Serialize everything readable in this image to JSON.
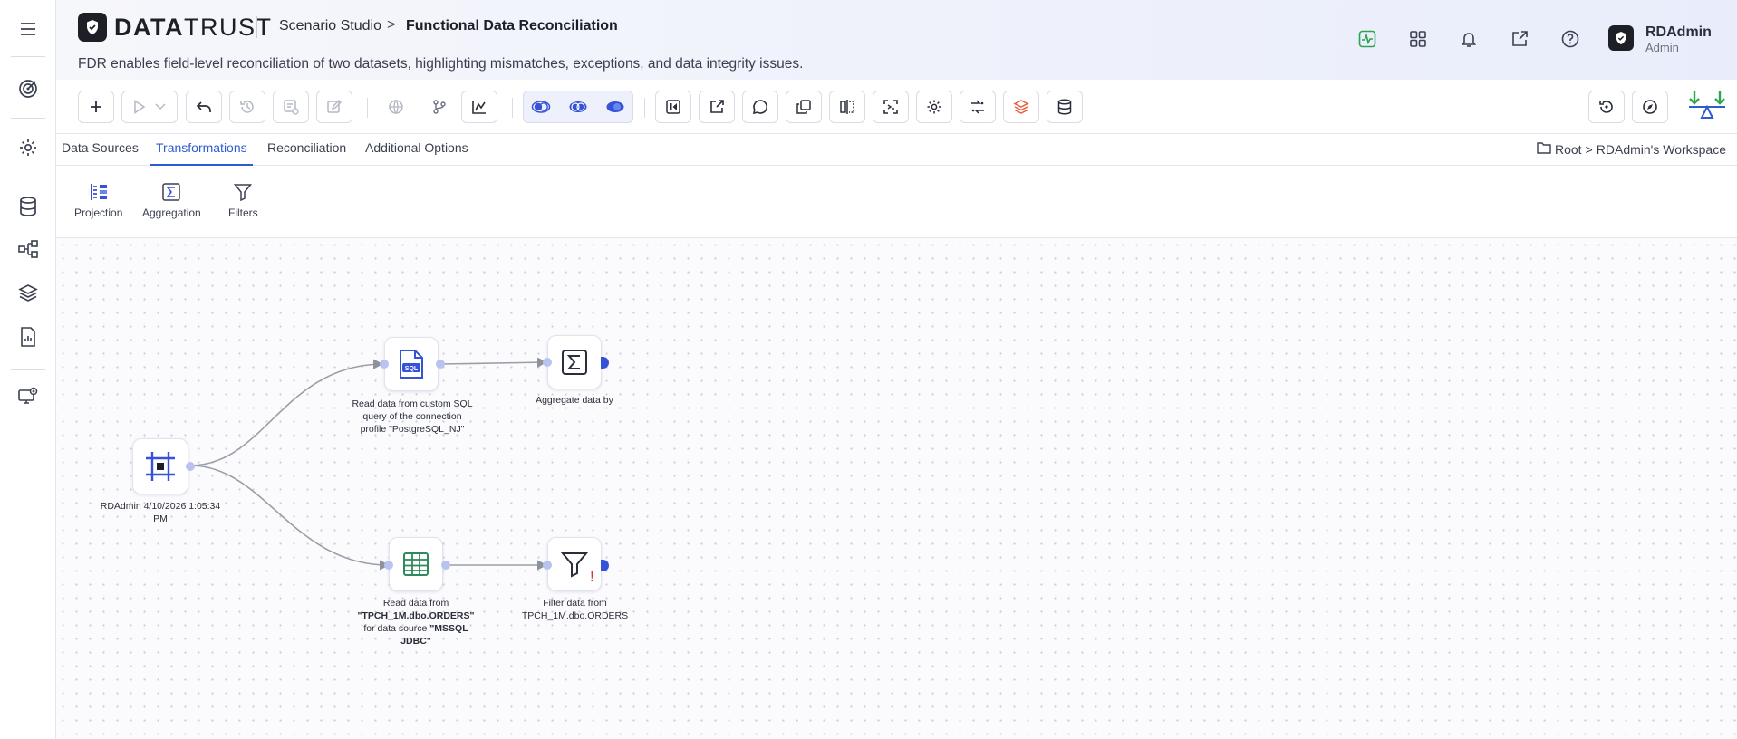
{
  "app": {
    "brand_bold": "DATA",
    "brand_light": "TRUST",
    "breadcrumb_parent": "Scenario Studio",
    "breadcrumb_sep": ">",
    "breadcrumb_current": "Functional Data Reconciliation",
    "subtitle": "FDR enables field-level reconciliation of two datasets, highlighting mismatches, exceptions, and data integrity issues."
  },
  "user": {
    "name": "RDAdmin",
    "role": "Admin"
  },
  "header_icons": [
    "activity-icon",
    "apps-grid-icon",
    "bell-icon",
    "external-link-icon",
    "help-icon"
  ],
  "sidebar_icons": [
    "menu-icon",
    "target-icon",
    "settings-icon",
    "database-icon",
    "workflow-icon",
    "layers-icon",
    "report-icon",
    "monitor-icon"
  ],
  "tabs": [
    {
      "label": "Data Sources"
    },
    {
      "label": "Transformations"
    },
    {
      "label": "Reconciliation"
    },
    {
      "label": "Additional Options"
    }
  ],
  "active_tab": "Transformations",
  "workspace": {
    "root": "Root",
    "sep": ">",
    "name": "RDAdmin's Workspace"
  },
  "palette": [
    {
      "label": "Projection"
    },
    {
      "label": "Aggregation"
    },
    {
      "label": "Filters"
    }
  ],
  "nodes": {
    "source": {
      "label": "RDAdmin 4/10/2026 1:05:34 PM"
    },
    "sql": {
      "label": "Read data from custom SQL query of the connection profile \"PostgreSQL_NJ\""
    },
    "aggregate": {
      "label": "Aggregate data by"
    },
    "table": {
      "label_pre": "Read data from ",
      "label_bold1": "\"TPCH_1M.dbo.ORDERS\"",
      "label_mid": " for data source ",
      "label_bold2": "\"MSSQL JDBC\""
    },
    "filter": {
      "label": "Filter data from TPCH_1M.dbo.ORDERS",
      "warning": "!"
    }
  },
  "colors": {
    "accent": "#2f5bd0",
    "node_port": "#b9c3f0",
    "warning": "#d63a3a",
    "green": "#2da44e"
  }
}
